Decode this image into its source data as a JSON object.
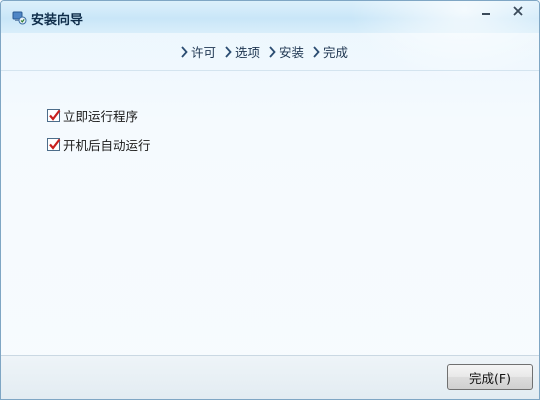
{
  "window": {
    "title": "安装向导",
    "controls": {
      "minimize_icon": "minimize-icon",
      "close_icon": "close-icon"
    }
  },
  "steps": [
    {
      "label": "许可",
      "icon": "chevron-right-icon"
    },
    {
      "label": "选项",
      "icon": "chevron-right-icon"
    },
    {
      "label": "安装",
      "icon": "chevron-right-icon"
    },
    {
      "label": "完成",
      "icon": "chevron-right-icon"
    }
  ],
  "options": [
    {
      "label": "立即运行程序",
      "checked": true
    },
    {
      "label": "开机后自动运行",
      "checked": true
    }
  ],
  "footer": {
    "finish_label": "完成(F)"
  },
  "colors": {
    "check_mark": "#c8201e",
    "title_text": "#0f2d4a",
    "border": "#7fa6c4"
  }
}
